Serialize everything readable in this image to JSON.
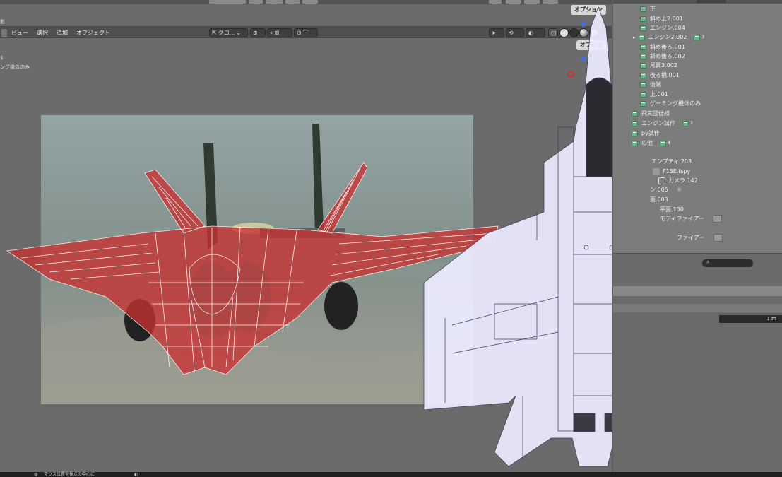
{
  "viewport": {
    "options_label": "オプション",
    "options_label_short": "オプショ",
    "overlay_text_1": "影",
    "overlay_text_2": "ング機体のみ",
    "overlay_text_3": "$"
  },
  "header_menu": {
    "view": "ビュー",
    "select": "選択",
    "add": "追加",
    "object": "オブジェクト"
  },
  "header_controls": {
    "transform_orientation": "グロ...",
    "snap": "--"
  },
  "outliner": {
    "rows": [
      {
        "label": "下",
        "indent": 2,
        "badge": ""
      },
      {
        "label": "斜め上2.001",
        "indent": 2,
        "badge": ""
      },
      {
        "label": "エンジン.004",
        "indent": 2,
        "badge": ""
      },
      {
        "label": "エンジン2.002",
        "indent": 2,
        "badge": "3"
      },
      {
        "label": "斜め後ろ.001",
        "indent": 2,
        "badge": ""
      },
      {
        "label": "斜め後ろ.002",
        "indent": 2,
        "badge": ""
      },
      {
        "label": "尾翼3.002",
        "indent": 2,
        "badge": ""
      },
      {
        "label": "後ろ横.001",
        "indent": 2,
        "badge": ""
      },
      {
        "label": "後端",
        "indent": 2,
        "badge": ""
      },
      {
        "label": "上.001",
        "indent": 2,
        "badge": ""
      },
      {
        "label": "ゲーミング機体のみ",
        "indent": 2,
        "badge": ""
      },
      {
        "label": "飛実団仕様",
        "indent": 1,
        "badge": ""
      },
      {
        "label": "エンジン試作",
        "indent": 1,
        "badge": "3"
      },
      {
        "label": "py試作",
        "indent": 1,
        "badge": ""
      },
      {
        "label": "の他",
        "indent": 1,
        "badge": "4"
      }
    ],
    "empty": "エンプティ.203",
    "script": "F15E.fspy",
    "camera": "カメラ.142",
    "light": "ン.005",
    "item_003": "面.003",
    "plane": "平面.130",
    "modifier_1": "モディファイアー",
    "modifier_2": "ファイアー"
  },
  "properties": {
    "search_icon": "search-icon",
    "unit_value": "1 m"
  },
  "statusbar": {
    "hint": "マウス位置を視点の中心に"
  },
  "colors": {
    "selection_red": "#c83232",
    "collection_green": "#6fb08a",
    "overlay_blueprint": "#e9e9ff"
  }
}
